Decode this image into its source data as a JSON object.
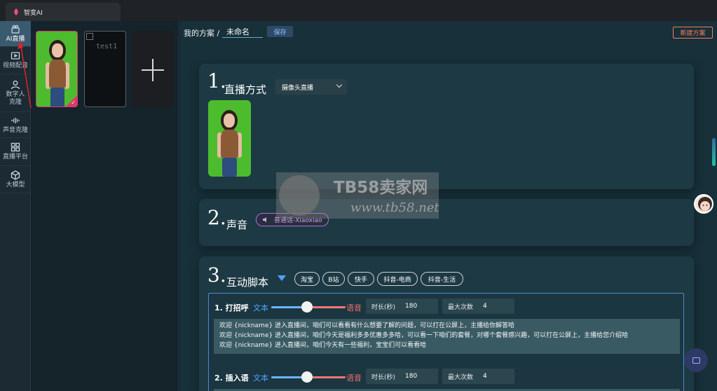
{
  "window": {
    "tab_title": "智变AI"
  },
  "sidebar": {
    "items": [
      {
        "label": "AI直播",
        "icon": "live-camera-icon",
        "active": true
      },
      {
        "label": "视频配音",
        "icon": "video-dub-icon"
      },
      {
        "label": "数字人克隆",
        "icon": "person-icon"
      },
      {
        "label": "声音克隆",
        "icon": "sound-wave-icon"
      },
      {
        "label": "直播平台",
        "icon": "grid-icon"
      },
      {
        "label": "大模型",
        "icon": "cube-icon"
      }
    ]
  },
  "thumbnails": {
    "second_label": "test1"
  },
  "topbar": {
    "breadcrumb": "我的方案 /",
    "plan_name": "未命名",
    "save_label": "保存",
    "new_plan_label": "新建方案"
  },
  "section1": {
    "number": "1.",
    "title": "直播方式",
    "mode": "摄像头直播"
  },
  "section2": {
    "number": "2.",
    "title": "声音",
    "voice": "普通话-Xiaoxiao"
  },
  "section3": {
    "number": "3.",
    "title": "互动脚本",
    "platforms": [
      "淘宝",
      "B站",
      "快手",
      "抖音-电商",
      "抖音-生活"
    ],
    "items": [
      {
        "title": "1. 打招呼",
        "text_label": "文本",
        "voice_label": "语音",
        "duration_label": "时长(秒)",
        "duration": "180",
        "max_label": "最大次数",
        "max_count": "4",
        "lines": [
          "欢迎 {nickname} 进入直播间，咱们可以看看有什么想要了解的问题，可以打在公屏上，主播给你解答哈",
          "欢迎 {nickname} 进入直播间，咱们今天是福利多多优惠多多哈，可以看一下咱们的套餐，对哪个套餐感兴趣，可以打在公屏上，主播给您介绍哈",
          "欢迎 {nickname} 进入直播间，咱们今天有一些福利，宝宝们可以看看哈"
        ]
      },
      {
        "title": "2. 插入语",
        "text_label": "文本",
        "voice_label": "语音",
        "duration_label": "时长(秒)",
        "duration": "180",
        "max_label": "最大次数",
        "max_count": "4"
      }
    ]
  },
  "watermark": {
    "title": "TB58卖家网",
    "url": "www.tb58.net"
  },
  "colors": {
    "accent_blue": "#4da3ff",
    "accent_red": "#f07070",
    "new_button": "#ff7a5c",
    "selected": "#d63a6c"
  }
}
